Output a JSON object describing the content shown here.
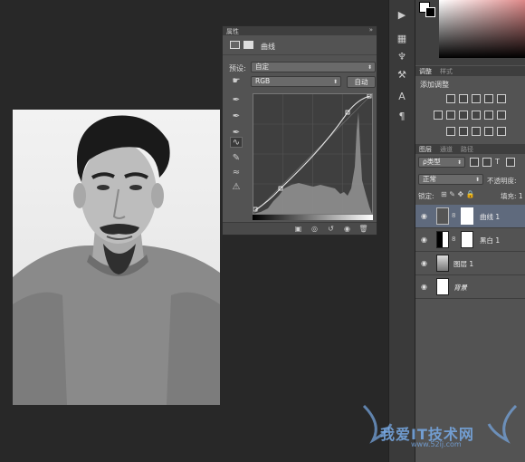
{
  "properties_panel": {
    "tab_title": "属性",
    "close_symbol": "»",
    "header_title": "曲线",
    "preset_label": "预设:",
    "preset_value": "自定",
    "channel_value": "RGB",
    "auto_button": "自动"
  },
  "adjustments_panel": {
    "tabs": [
      "调整",
      "样式"
    ],
    "add_label": "添加调整"
  },
  "layers_panel": {
    "tabs": [
      "图层",
      "通道",
      "路径"
    ],
    "kind_filter": "ρ类型",
    "blend_mode": "正常",
    "opacity_label": "不透明度:",
    "lock_label": "锁定:",
    "fill_label": "填充: 1",
    "layers": [
      {
        "name": "曲线 1",
        "selected": true
      },
      {
        "name": "黑白 1",
        "selected": false
      },
      {
        "name": "图层 1",
        "selected": false
      },
      {
        "name": "背景",
        "selected": false
      }
    ]
  },
  "watermark": {
    "title": "我爱IT技术网",
    "url": "www.52ij.com"
  }
}
